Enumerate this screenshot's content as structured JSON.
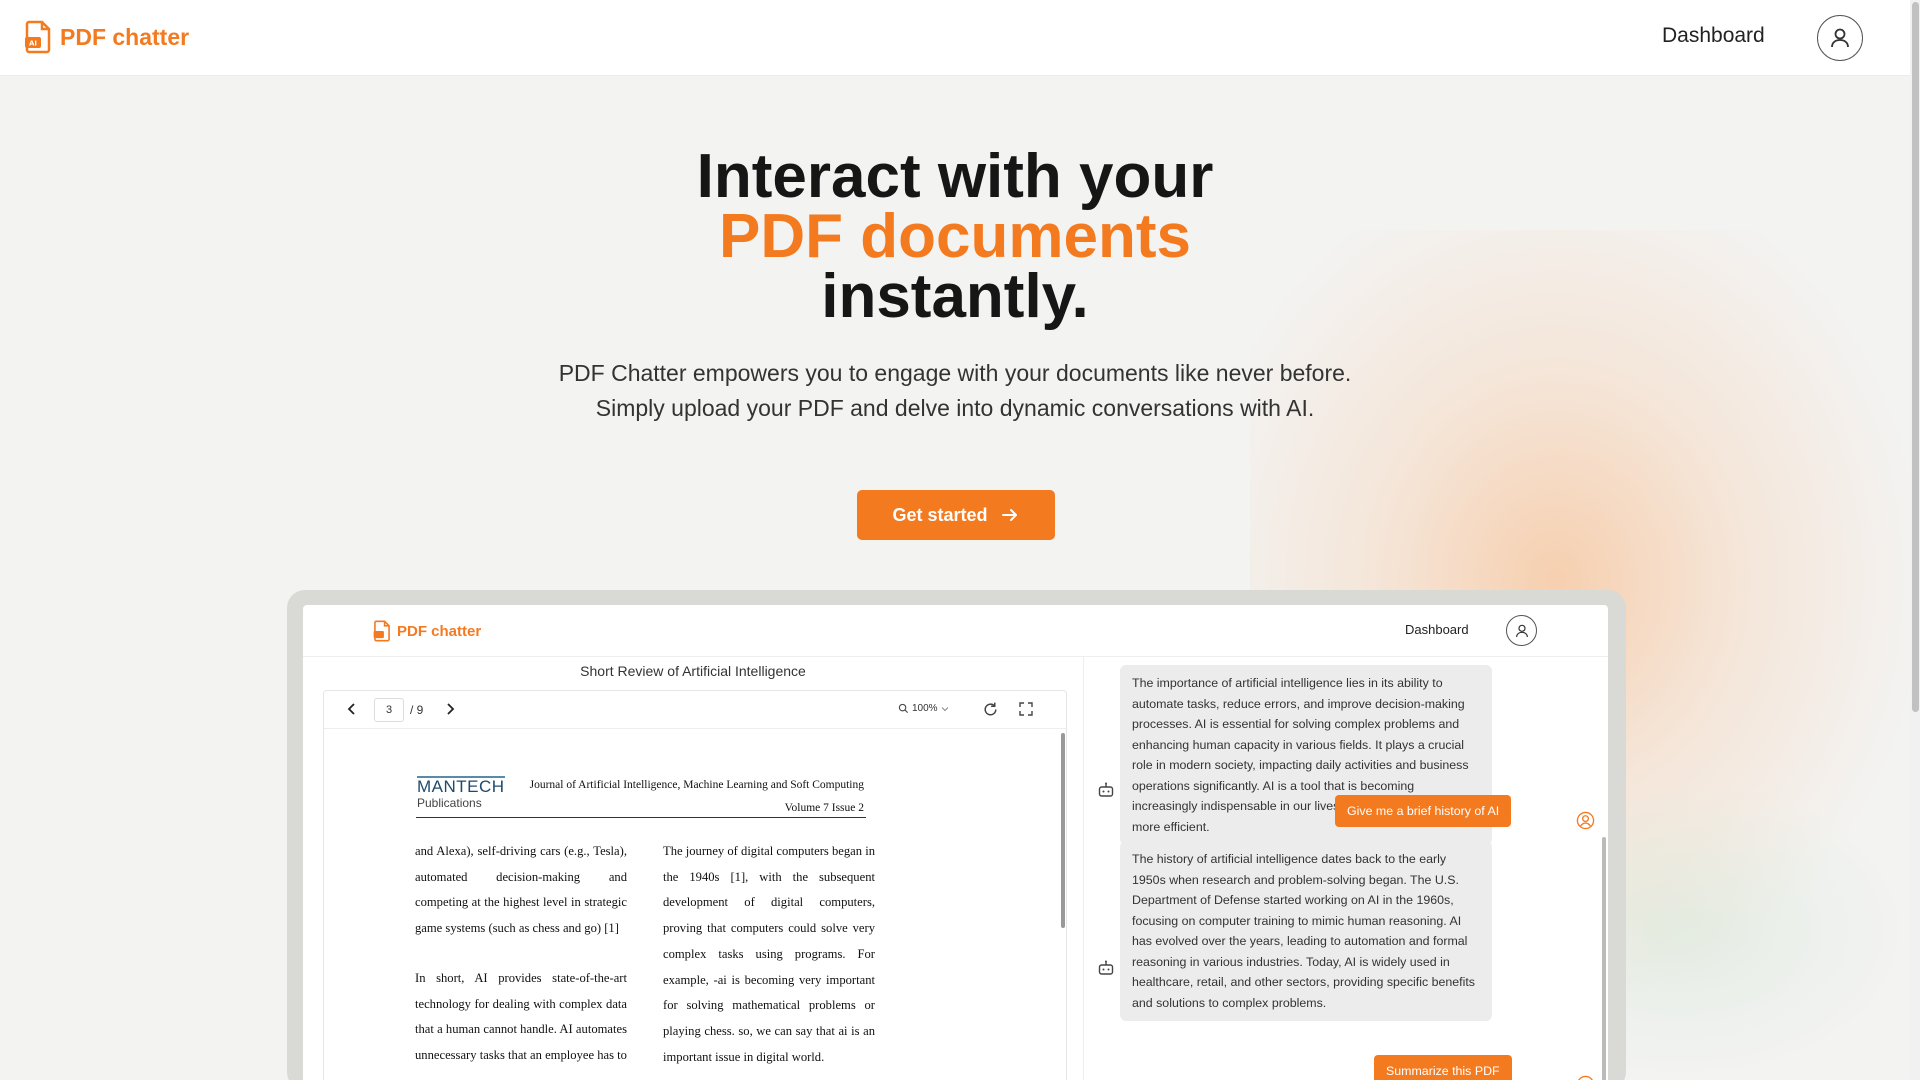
{
  "header": {
    "brand": "PDF chatter",
    "dashboard": "Dashboard"
  },
  "hero": {
    "line1": "Interact with your",
    "line2": "PDF documents",
    "line3": "instantly.",
    "subtitle": "PDF Chatter empowers you to engage with your documents like never before. Simply upload your PDF and delve into dynamic conversations with AI.",
    "cta": "Get started"
  },
  "preview": {
    "brand": "PDF chatter",
    "dashboard": "Dashboard",
    "doc_title": "Short Review of Artificial Intelligence",
    "toolbar": {
      "page": "3",
      "total": "/ 9",
      "zoom": "100%"
    },
    "document": {
      "logo_main": "MANTECH",
      "logo_sub": "Publications",
      "journal": "Journal of Artificial Intelligence, Machine Learning and Soft Computing",
      "volume": "Volume 7 Issue 2",
      "col1_p1": "and Alexa), self-driving cars (e.g., Tesla), automated decision-making and competing at the highest level in strategic game systems (such as chess and go) [1]",
      "col1_p2": "In short, AI provides state-of-the-art technology for dealing with complex data that a human cannot handle. AI automates unnecessary tasks that an employee has to",
      "col2_p1": "The journey of digital computers began in the 1940s [1], with the subsequent development of digital computers, proving that computers could solve very complex tasks using programs. For example, -ai is becoming very important for solving mathematical problems or playing chess. so, we can say that ai is an important issue in digital world."
    },
    "chat": {
      "bot1": "The importance of artificial intelligence lies in its ability to automate tasks, reduce errors, and improve decision-making processes. AI is essential for solving complex problems and enhancing human capacity in various fields. It plays a crucial role in modern society, impacting daily activities and business operations significantly. AI is a tool that is becoming increasingly indispensable in our lives, making tasks easier and more efficient.",
      "user1": "Give me a brief history of AI",
      "bot2": "The history of artificial intelligence dates back to the early 1950s when research and problem-solving began. The U.S. Department of Defense started working on AI in the 1960s, focusing on computer training to mimic human reasoning. AI has evolved over the years, leading to automation and formal reasoning in various industries. Today, AI is widely used in healthcare, retail, and other sectors, providing specific benefits and solutions to complex problems.",
      "user2": "Summarize this PDF"
    }
  },
  "colors": {
    "accent": "#f47a20",
    "bot_bubble": "#ececec",
    "background": "#f3f3f2"
  },
  "icons": [
    "pdf-ai-icon",
    "user-icon",
    "arrow-right-icon",
    "chevron-left-icon",
    "chevron-right-icon",
    "search-icon",
    "rotate-icon",
    "fullscreen-icon",
    "robot-icon"
  ]
}
